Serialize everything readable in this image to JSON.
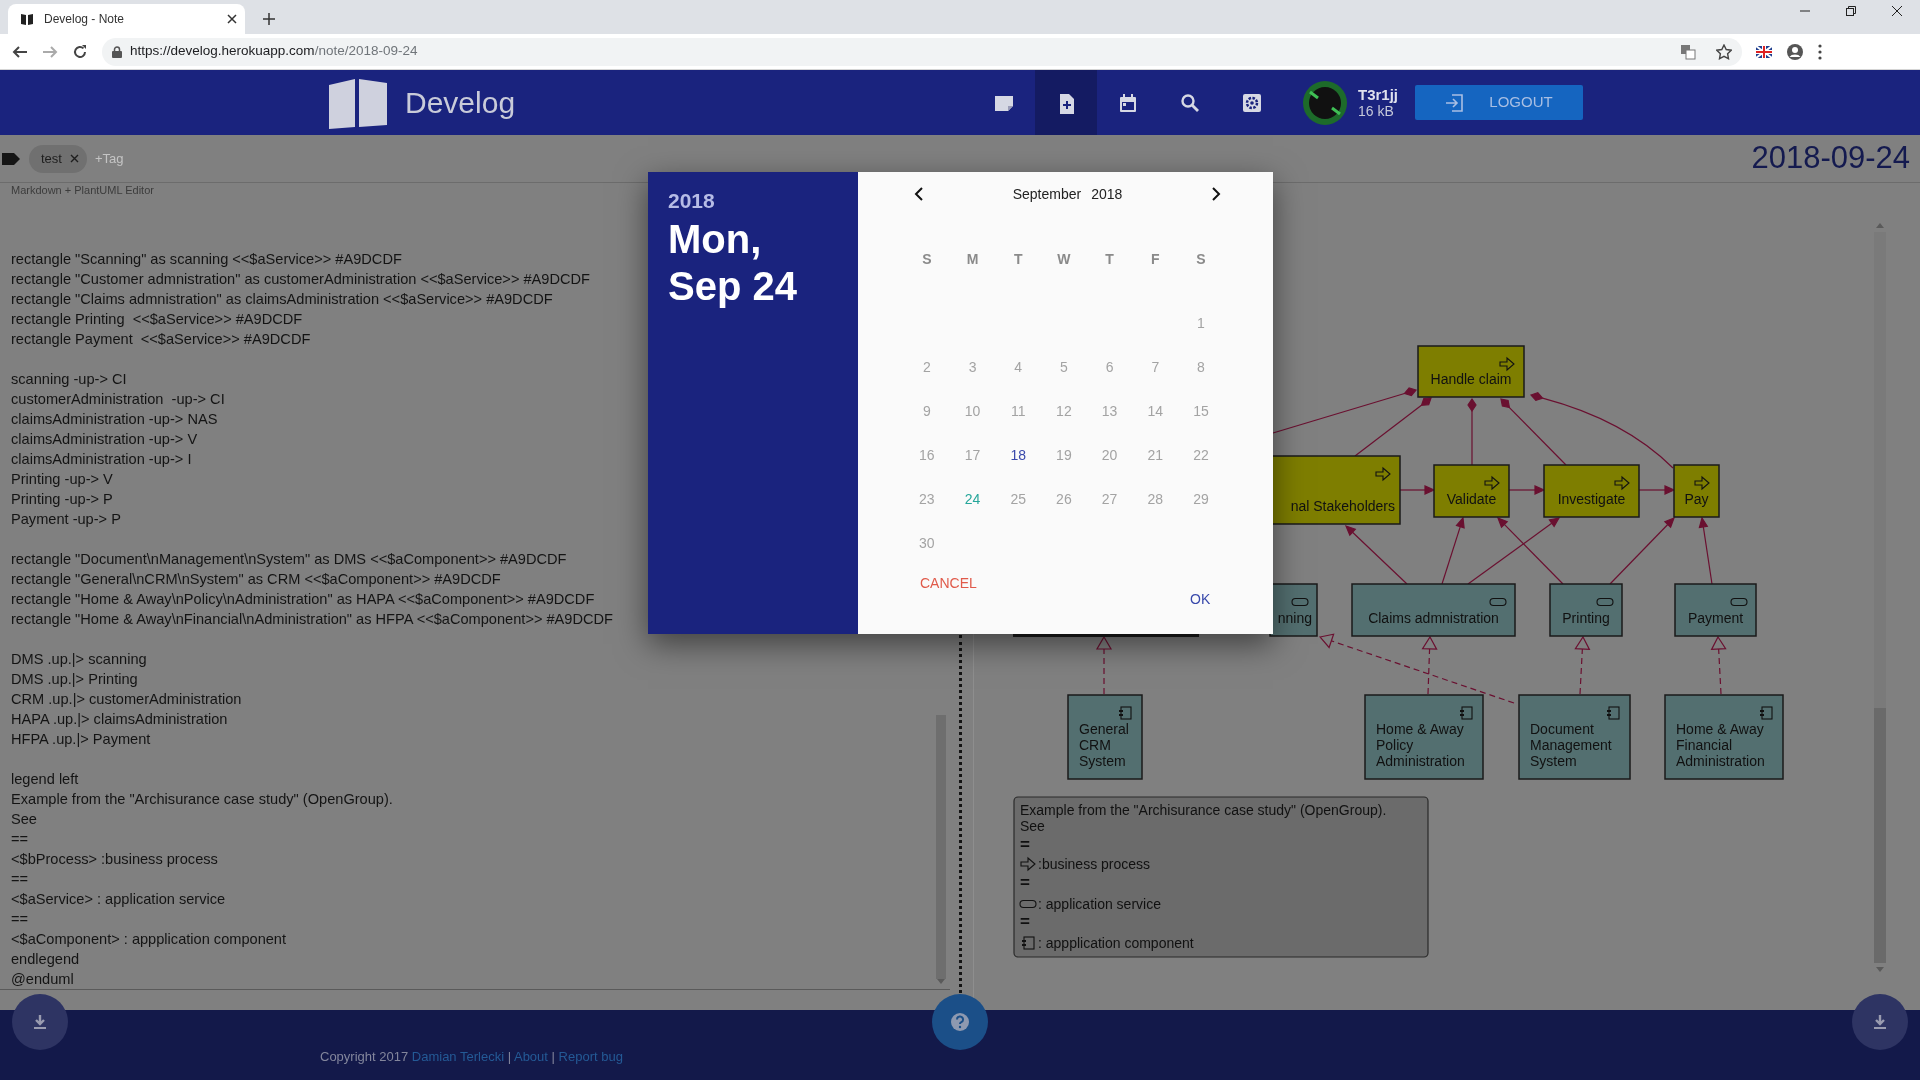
{
  "browser": {
    "tab_title": "Develog - Note",
    "url_host": "https://develog.herokuapp.com",
    "url_path": "/note/2018-09-24"
  },
  "header": {
    "brand": "Develog",
    "nav": [
      {
        "kind": "notes",
        "selected": false
      },
      {
        "kind": "new_note",
        "selected": true
      },
      {
        "kind": "calendar",
        "selected": false
      },
      {
        "kind": "search",
        "selected": false
      },
      {
        "kind": "settings",
        "selected": false
      }
    ],
    "user": {
      "name": "T3r1jj",
      "storage": "16 kB"
    },
    "logout": "LOGOUT"
  },
  "tags": {
    "items": [
      {
        "label": "test"
      }
    ],
    "placeholder": "+Tag"
  },
  "date_heading": "2018-09-24",
  "editor": {
    "label": "Markdown + PlantUML Editor",
    "blocks": [
      [
        "rectangle \"Scanning\" as scanning <<$aService>> #A9DCDF",
        "rectangle \"Customer admnistration\" as customerAdministration <<$aService>> #A9DCDF",
        "rectangle \"Claims admnistration\" as claimsAdministration <<$aService>> #A9DCDF",
        "rectangle Printing  <<$aService>> #A9DCDF",
        "rectangle Payment  <<$aService>> #A9DCDF"
      ],
      [
        "scanning -up-> CI",
        "customerAdministration  -up-> CI",
        "claimsAdministration -up-> NAS",
        "claimsAdministration -up-> V",
        "claimsAdministration -up-> I",
        "Printing -up-> V",
        "Printing -up-> P",
        "Payment -up-> P"
      ],
      [
        "rectangle \"Document\\nManagement\\nSystem\" as DMS <<$aComponent>> #A9DCDF",
        "rectangle \"General\\nCRM\\nSystem\" as CRM <<$aComponent>> #A9DCDF",
        "rectangle \"Home & Away\\nPolicy\\nAdministration\" as HAPA <<$aComponent>> #A9DCDF",
        "rectangle \"Home & Away\\nFinancial\\nAdministration\" as HFPA <<$aComponent>> #A9DCDF"
      ],
      [
        "DMS .up.|> scanning",
        "DMS .up.|> Printing",
        "CRM .up.|> customerAdministration",
        "HAPA .up.|> claimsAdministration",
        "HFPA .up.|> Payment"
      ],
      [
        "legend left",
        "Example from the \"Archisurance case study\" (OpenGroup).",
        "See",
        "==",
        "<$bProcess> :business process",
        "==",
        "<$aService> : application service",
        "==",
        "<$aComponent> : appplication component",
        "endlegend",
        "@enduml"
      ]
    ]
  },
  "diagram": {
    "nodes": [
      {
        "kind": "process",
        "lines": [
          "Handle claim"
        ]
      },
      {
        "kind": "process",
        "lines": [
          "nal Stakeholders"
        ]
      },
      {
        "kind": "process",
        "lines": [
          "Validate"
        ]
      },
      {
        "kind": "process",
        "lines": [
          "Investigate"
        ]
      },
      {
        "kind": "process",
        "lines": [
          "Pay"
        ]
      },
      {
        "kind": "service",
        "lines": [
          "nning"
        ]
      },
      {
        "kind": "service",
        "lines": [
          "Claims admnistration"
        ]
      },
      {
        "kind": "service",
        "lines": [
          "Printing"
        ]
      },
      {
        "kind": "service",
        "lines": [
          "Payment"
        ]
      },
      {
        "kind": "component",
        "lines": [
          "General",
          "CRM",
          "System"
        ]
      },
      {
        "kind": "component",
        "lines": [
          "Home & Away",
          "Policy",
          "Administration"
        ]
      },
      {
        "kind": "component",
        "lines": [
          "Document",
          "Management",
          "System"
        ]
      },
      {
        "kind": "component",
        "lines": [
          "Home & Away",
          "Financial",
          "Administration"
        ]
      }
    ],
    "legend": [
      {
        "kind": "text",
        "text": "Example from the \"Archisurance case study\" (OpenGroup)."
      },
      {
        "kind": "text",
        "text": "See"
      },
      {
        "kind": "separator",
        "text": "="
      },
      {
        "kind": "process",
        "text": ":business process"
      },
      {
        "kind": "separator",
        "text": "="
      },
      {
        "kind": "service",
        "text": ": application service"
      },
      {
        "kind": "separator",
        "text": "="
      },
      {
        "kind": "component",
        "text": ": appplication component"
      }
    ]
  },
  "datepicker": {
    "year": "2018",
    "date": "Mon, Sep 24",
    "month": "September",
    "month_year": "2018",
    "weekdays": [
      "S",
      "M",
      "T",
      "W",
      "T",
      "F",
      "S"
    ],
    "days": [
      {
        "label": "1",
        "selected": false,
        "today": false
      },
      {
        "label": "2",
        "selected": false,
        "today": false
      },
      {
        "label": "3",
        "selected": false,
        "today": false
      },
      {
        "label": "4",
        "selected": false,
        "today": false
      },
      {
        "label": "5",
        "selected": false,
        "today": false
      },
      {
        "label": "6",
        "selected": false,
        "today": false
      },
      {
        "label": "7",
        "selected": false,
        "today": false
      },
      {
        "label": "8",
        "selected": false,
        "today": false
      },
      {
        "label": "9",
        "selected": false,
        "today": false
      },
      {
        "label": "10",
        "selected": false,
        "today": false
      },
      {
        "label": "11",
        "selected": false,
        "today": false
      },
      {
        "label": "12",
        "selected": false,
        "today": false
      },
      {
        "label": "13",
        "selected": false,
        "today": false
      },
      {
        "label": "14",
        "selected": false,
        "today": false
      },
      {
        "label": "15",
        "selected": false,
        "today": false
      },
      {
        "label": "16",
        "selected": false,
        "today": false
      },
      {
        "label": "17",
        "selected": false,
        "today": false
      },
      {
        "label": "18",
        "selected": false,
        "today": true
      },
      {
        "label": "19",
        "selected": false,
        "today": false
      },
      {
        "label": "20",
        "selected": false,
        "today": false
      },
      {
        "label": "21",
        "selected": false,
        "today": false
      },
      {
        "label": "22",
        "selected": false,
        "today": false
      },
      {
        "label": "23",
        "selected": false,
        "today": false
      },
      {
        "label": "24",
        "selected": true,
        "today": false
      },
      {
        "label": "25",
        "selected": false,
        "today": false
      },
      {
        "label": "26",
        "selected": false,
        "today": false
      },
      {
        "label": "27",
        "selected": false,
        "today": false
      },
      {
        "label": "28",
        "selected": false,
        "today": false
      },
      {
        "label": "29",
        "selected": false,
        "today": false
      },
      {
        "label": "30",
        "selected": false,
        "today": false
      }
    ],
    "cancel": "CANCEL",
    "ok": "OK"
  },
  "footer": {
    "parts": [
      {
        "kind": "text",
        "text": "Copyright 2017"
      },
      {
        "kind": "link",
        "text": "Damian Terlecki"
      },
      {
        "kind": "text",
        "text": "|"
      },
      {
        "kind": "link",
        "text": "About"
      },
      {
        "kind": "text",
        "text": "|"
      },
      {
        "kind": "link",
        "text": "Report bug"
      }
    ]
  }
}
